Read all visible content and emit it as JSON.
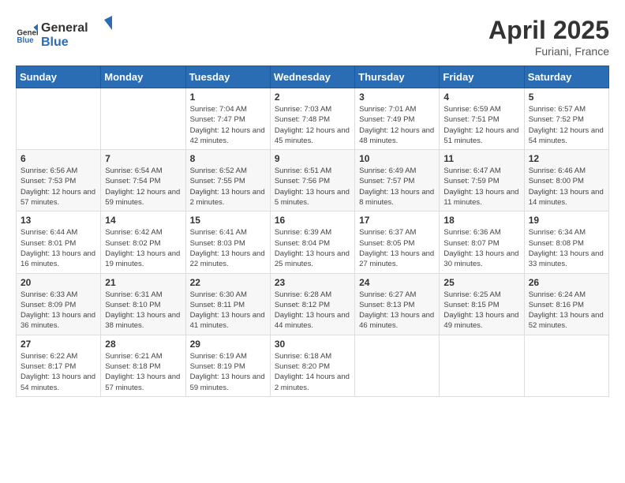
{
  "header": {
    "logo_general": "General",
    "logo_blue": "Blue",
    "title": "April 2025",
    "location": "Furiani, France"
  },
  "calendar": {
    "days_of_week": [
      "Sunday",
      "Monday",
      "Tuesday",
      "Wednesday",
      "Thursday",
      "Friday",
      "Saturday"
    ],
    "weeks": [
      [
        {
          "day": "",
          "detail": ""
        },
        {
          "day": "",
          "detail": ""
        },
        {
          "day": "1",
          "detail": "Sunrise: 7:04 AM\nSunset: 7:47 PM\nDaylight: 12 hours and 42 minutes."
        },
        {
          "day": "2",
          "detail": "Sunrise: 7:03 AM\nSunset: 7:48 PM\nDaylight: 12 hours and 45 minutes."
        },
        {
          "day": "3",
          "detail": "Sunrise: 7:01 AM\nSunset: 7:49 PM\nDaylight: 12 hours and 48 minutes."
        },
        {
          "day": "4",
          "detail": "Sunrise: 6:59 AM\nSunset: 7:51 PM\nDaylight: 12 hours and 51 minutes."
        },
        {
          "day": "5",
          "detail": "Sunrise: 6:57 AM\nSunset: 7:52 PM\nDaylight: 12 hours and 54 minutes."
        }
      ],
      [
        {
          "day": "6",
          "detail": "Sunrise: 6:56 AM\nSunset: 7:53 PM\nDaylight: 12 hours and 57 minutes."
        },
        {
          "day": "7",
          "detail": "Sunrise: 6:54 AM\nSunset: 7:54 PM\nDaylight: 12 hours and 59 minutes."
        },
        {
          "day": "8",
          "detail": "Sunrise: 6:52 AM\nSunset: 7:55 PM\nDaylight: 13 hours and 2 minutes."
        },
        {
          "day": "9",
          "detail": "Sunrise: 6:51 AM\nSunset: 7:56 PM\nDaylight: 13 hours and 5 minutes."
        },
        {
          "day": "10",
          "detail": "Sunrise: 6:49 AM\nSunset: 7:57 PM\nDaylight: 13 hours and 8 minutes."
        },
        {
          "day": "11",
          "detail": "Sunrise: 6:47 AM\nSunset: 7:59 PM\nDaylight: 13 hours and 11 minutes."
        },
        {
          "day": "12",
          "detail": "Sunrise: 6:46 AM\nSunset: 8:00 PM\nDaylight: 13 hours and 14 minutes."
        }
      ],
      [
        {
          "day": "13",
          "detail": "Sunrise: 6:44 AM\nSunset: 8:01 PM\nDaylight: 13 hours and 16 minutes."
        },
        {
          "day": "14",
          "detail": "Sunrise: 6:42 AM\nSunset: 8:02 PM\nDaylight: 13 hours and 19 minutes."
        },
        {
          "day": "15",
          "detail": "Sunrise: 6:41 AM\nSunset: 8:03 PM\nDaylight: 13 hours and 22 minutes."
        },
        {
          "day": "16",
          "detail": "Sunrise: 6:39 AM\nSunset: 8:04 PM\nDaylight: 13 hours and 25 minutes."
        },
        {
          "day": "17",
          "detail": "Sunrise: 6:37 AM\nSunset: 8:05 PM\nDaylight: 13 hours and 27 minutes."
        },
        {
          "day": "18",
          "detail": "Sunrise: 6:36 AM\nSunset: 8:07 PM\nDaylight: 13 hours and 30 minutes."
        },
        {
          "day": "19",
          "detail": "Sunrise: 6:34 AM\nSunset: 8:08 PM\nDaylight: 13 hours and 33 minutes."
        }
      ],
      [
        {
          "day": "20",
          "detail": "Sunrise: 6:33 AM\nSunset: 8:09 PM\nDaylight: 13 hours and 36 minutes."
        },
        {
          "day": "21",
          "detail": "Sunrise: 6:31 AM\nSunset: 8:10 PM\nDaylight: 13 hours and 38 minutes."
        },
        {
          "day": "22",
          "detail": "Sunrise: 6:30 AM\nSunset: 8:11 PM\nDaylight: 13 hours and 41 minutes."
        },
        {
          "day": "23",
          "detail": "Sunrise: 6:28 AM\nSunset: 8:12 PM\nDaylight: 13 hours and 44 minutes."
        },
        {
          "day": "24",
          "detail": "Sunrise: 6:27 AM\nSunset: 8:13 PM\nDaylight: 13 hours and 46 minutes."
        },
        {
          "day": "25",
          "detail": "Sunrise: 6:25 AM\nSunset: 8:15 PM\nDaylight: 13 hours and 49 minutes."
        },
        {
          "day": "26",
          "detail": "Sunrise: 6:24 AM\nSunset: 8:16 PM\nDaylight: 13 hours and 52 minutes."
        }
      ],
      [
        {
          "day": "27",
          "detail": "Sunrise: 6:22 AM\nSunset: 8:17 PM\nDaylight: 13 hours and 54 minutes."
        },
        {
          "day": "28",
          "detail": "Sunrise: 6:21 AM\nSunset: 8:18 PM\nDaylight: 13 hours and 57 minutes."
        },
        {
          "day": "29",
          "detail": "Sunrise: 6:19 AM\nSunset: 8:19 PM\nDaylight: 13 hours and 59 minutes."
        },
        {
          "day": "30",
          "detail": "Sunrise: 6:18 AM\nSunset: 8:20 PM\nDaylight: 14 hours and 2 minutes."
        },
        {
          "day": "",
          "detail": ""
        },
        {
          "day": "",
          "detail": ""
        },
        {
          "day": "",
          "detail": ""
        }
      ]
    ]
  }
}
